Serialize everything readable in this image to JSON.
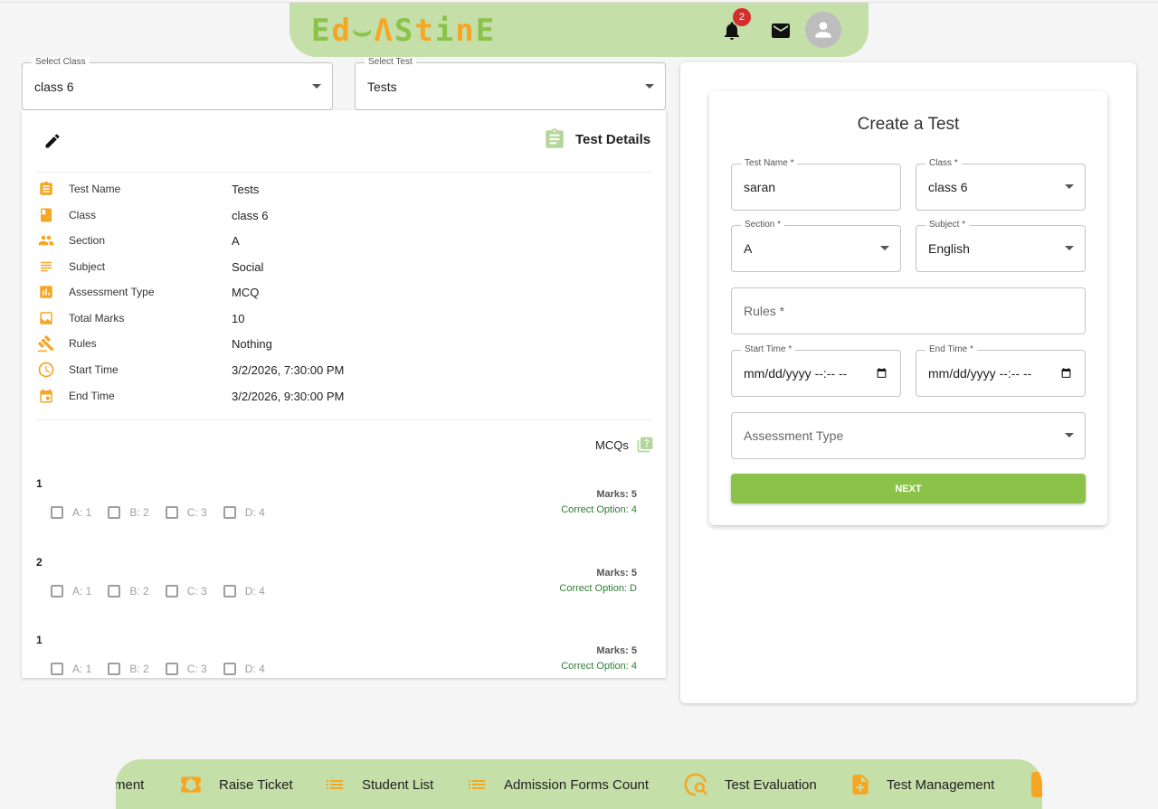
{
  "header": {
    "logo_text": "Ed⌣nStinE",
    "notification_count": "2",
    "logo_letters": [
      "E",
      "d",
      "⌣",
      "Λ",
      "S",
      "t",
      "i",
      "n",
      "E"
    ]
  },
  "filters": {
    "class_label": "Select Class",
    "class_value": "class 6",
    "test_label": "Select Test",
    "test_value": "Tests"
  },
  "details": {
    "title": "Test Details",
    "rows": [
      {
        "key": "Test Name",
        "value": "Tests",
        "icon": "clipboard-icon"
      },
      {
        "key": "Class",
        "value": "class 6",
        "icon": "book-icon"
      },
      {
        "key": "Section",
        "value": "A",
        "icon": "people-icon"
      },
      {
        "key": "Subject",
        "value": "Social",
        "icon": "subject-icon"
      },
      {
        "key": "Assessment Type",
        "value": "MCQ",
        "icon": "bar-chart-icon"
      },
      {
        "key": "Total Marks",
        "value": "10",
        "icon": "marks-icon"
      },
      {
        "key": "Rules",
        "value": "Nothing",
        "icon": "gavel-icon"
      },
      {
        "key": "Start Time",
        "value": "3/2/2026, 7:30:00 PM",
        "icon": "clock-icon"
      },
      {
        "key": "End Time",
        "value": "3/2/2026, 9:30:00 PM",
        "icon": "calendar-icon"
      }
    ],
    "mcq_label": "MCQs",
    "questions": [
      {
        "num": "1",
        "options": [
          "A: 1",
          "B: 2",
          "C: 3",
          "D: 4"
        ],
        "marks": "Marks: 5",
        "correct": "Correct Option: 4"
      },
      {
        "num": "2",
        "options": [
          "A: 1",
          "B: 2",
          "C: 3",
          "D: 4"
        ],
        "marks": "Marks: 5",
        "correct": "Correct Option: D"
      },
      {
        "num": "1",
        "options": [
          "A: 1",
          "B: 2",
          "C: 3",
          "D: 4"
        ],
        "marks": "Marks: 5",
        "correct": "Correct Option: 4"
      }
    ]
  },
  "create": {
    "title": "Create a Test",
    "test_name_label": "Test Name *",
    "test_name_value": "saran",
    "class_label": "Class *",
    "class_value": "class 6",
    "section_label": "Section *",
    "section_value": "A",
    "subject_label": "Subject *",
    "subject_value": "English",
    "rules_placeholder": "Rules *",
    "start_label": "Start Time *",
    "start_value": "mm/dd/yyyy --:-- --",
    "end_label": "End Time *",
    "end_value": "mm/dd/yyyy --:-- --",
    "assessment_placeholder": "Assessment Type",
    "next_label": "NEXT"
  },
  "bottom_nav": {
    "items": [
      {
        "label": "ment",
        "icon": ""
      },
      {
        "label": "Raise Ticket",
        "icon": "star-ticket-icon"
      },
      {
        "label": "Student List",
        "icon": "list-icon"
      },
      {
        "label": "Admission Forms Count",
        "icon": "list-icon"
      },
      {
        "label": "Test Evaluation",
        "icon": "search-pulse-icon"
      },
      {
        "label": "Test Management",
        "icon": "file-add-icon"
      }
    ]
  },
  "colors": {
    "accent_green": "#8bc34a",
    "header_green": "#c5dfa9",
    "icon_orange": "#f5a623",
    "badge_red": "#d32f2f",
    "correct_green": "#2e7d32"
  }
}
